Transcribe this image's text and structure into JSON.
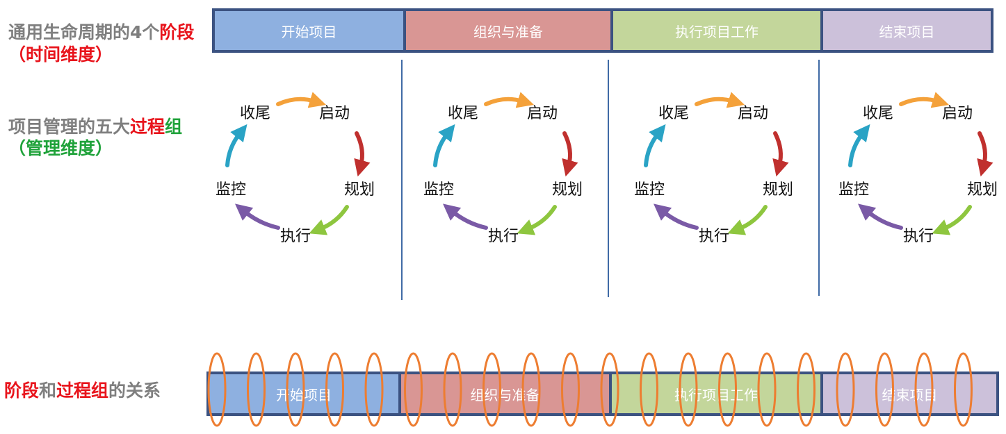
{
  "labels": {
    "time_row": {
      "prefix": "通用生命周期的4个",
      "highlight": "阶段",
      "sub": "（时间维度）"
    },
    "mgmt_row": {
      "prefix": "项目管理的五大",
      "highlight_red": "过程",
      "highlight_green": "组",
      "sub": "（管理维度）"
    },
    "relation_row": {
      "part1": "阶段",
      "part2": "和",
      "part3": "过程组",
      "part4": "的关系"
    }
  },
  "phases": [
    {
      "label": "开始项目",
      "color": "#8eb0e0"
    },
    {
      "label": "组织与准备",
      "color": "#d99694"
    },
    {
      "label": "执行项目工作",
      "color": "#c3d69b"
    },
    {
      "label": "结束项目",
      "color": "#ccc1da"
    }
  ],
  "cycle": {
    "closing": "收尾",
    "initiating": "启动",
    "planning": "规划",
    "executing": "执行",
    "monitoring": "监控"
  },
  "colors": {
    "border": "#3b5281",
    "divider": "#3f6aa5",
    "coil": "#ed7d31",
    "arrow_orange": "#f4a13a",
    "arrow_red": "#c0302e",
    "arrow_green": "#8ec63f",
    "arrow_purple": "#7a5aa6",
    "arrow_teal": "#2aa3c5"
  }
}
